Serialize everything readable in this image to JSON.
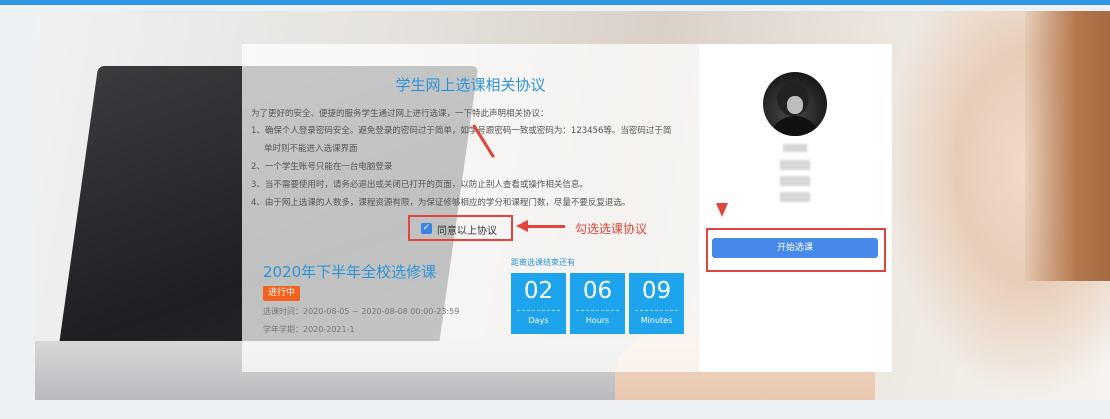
{
  "agreement": {
    "title": "学生网上选课相关协议",
    "intro": "为了更好的安全、便捷的服务学生通过网上进行选课，一下特此声明相关协议：",
    "rules": [
      {
        "line1": "1、确保个人登录密码安全。避免登录的密码过于简单，如学号跟密码一致或密码为：123456等。当密码过于简",
        "line2": "单时则不能进入选课界面"
      },
      {
        "line1": "2、一个学生账号只能在一台电脑登录"
      },
      {
        "line1": "3、当不需要使用时，请务必退出或关闭已打开的页面，以防止别人查看或操作相关信息。"
      },
      {
        "line1": "4、由于网上选课的人数多，课程资源有限，为保证修够相应的学分和课程门数，尽量不要反复退选。"
      }
    ],
    "checkbox_label": "同意以上协议",
    "checked": true
  },
  "annotation": {
    "hint": "勾选选课协议",
    "color": "#e0443c"
  },
  "term": {
    "title": "2020年下半年全校选修课",
    "status": "进行中",
    "period": "选课时间：2020-08-05 ~ 2020-08-08 00:00-23:59",
    "semester": "学年学期：2020-2021-1"
  },
  "countdown": {
    "label": "距离选课结束还有",
    "days": "02",
    "days_unit": "Days",
    "hours": "06",
    "hours_unit": "Hours",
    "minutes": "09",
    "minutes_unit": "Minutes"
  },
  "user": {
    "avatar_icon": "user-avatar",
    "start_button": "开始选课"
  },
  "colors": {
    "accent": "#2b94d9",
    "countdown_bg": "#1da4ec",
    "button": "#4789e8",
    "badge": "#f3611c"
  }
}
